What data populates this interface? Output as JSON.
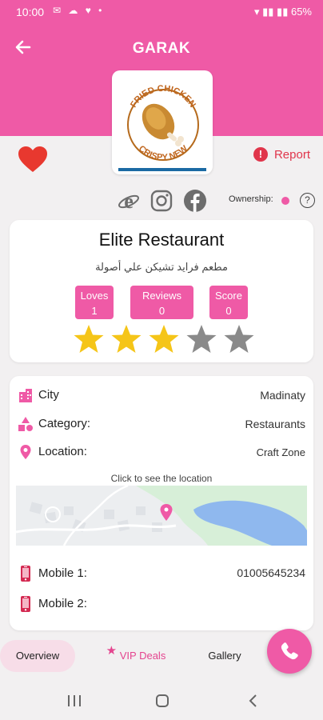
{
  "status_bar": {
    "time": "10:00",
    "battery": "65%"
  },
  "header": {
    "title": "GARAK"
  },
  "logo": {
    "text_top": "FRIED CHICKEN",
    "text_bottom": "CRISPY NEW"
  },
  "actions": {
    "report_label": "Report",
    "ownership_label": "Ownership:"
  },
  "restaurant": {
    "name": "Elite Restaurant",
    "arabic_name": "مطعم فرايد تشيكن علي أصولة",
    "stats": [
      {
        "label": "Loves",
        "value": "1"
      },
      {
        "label": "Reviews",
        "value": "0"
      },
      {
        "label": "Score",
        "value": "0"
      }
    ],
    "rating": 3,
    "rating_max": 5
  },
  "details": {
    "city_label": "City",
    "city_value": "Madinaty",
    "category_label": "Category:",
    "category_value": "Restaurants",
    "location_label": "Location:",
    "location_value": "Craft Zone",
    "map_hint": "Click to see the location",
    "mobile1_label": "Mobile 1:",
    "mobile1_value": "01005645234",
    "mobile2_label": "Mobile 2:",
    "mobile2_value": ""
  },
  "tabs": {
    "overview": "Overview",
    "vip_deals": "VIP Deals",
    "gallery": "Gallery"
  },
  "colors": {
    "brand_pink": "#ef5aa6",
    "report_red": "#e0354b",
    "star_gold": "#f5c518",
    "star_gray": "#8a8a8a"
  }
}
